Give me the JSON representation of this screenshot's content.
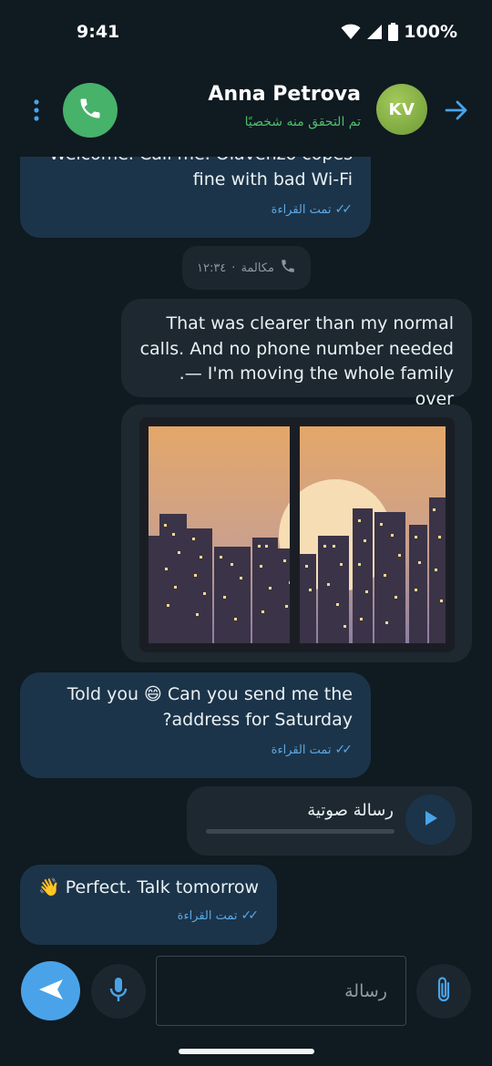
{
  "status_bar": {
    "time": "9:41",
    "battery": "100%",
    "icons": [
      "wifi-icon",
      "signal-icon",
      "battery-icon"
    ]
  },
  "header": {
    "contact_name": "Anna Petrova",
    "contact_status": "تم التحقق منه شخصيًا",
    "avatar_initials": "KV",
    "icons": [
      "more-vertical-icon",
      "phone-icon",
      "arrow-right-icon"
    ]
  },
  "messages": [
    {
      "id": "m1",
      "direction": "incoming",
      "text_clipped": "Welcome. Call me. Olavenzo copes",
      "text": "fine with bad Wi-Fi",
      "receipt": "تمت القراءة"
    },
    {
      "id": "call",
      "type": "call-event",
      "label": "مكالمة",
      "time": "١٢:٣٤"
    },
    {
      "id": "m2",
      "direction": "outgoing",
      "text": "That was clearer than my normal\ncalls. And no phone number needed\n.— I'm moving the whole family over"
    },
    {
      "id": "m3",
      "direction": "outgoing",
      "type": "image",
      "image_subject": "city skyline at sunset through a window"
    },
    {
      "id": "m4",
      "direction": "incoming",
      "text": "Told you 😄 Can you send me the\n?address for Saturday",
      "receipt": "تمت القراءة"
    },
    {
      "id": "m5",
      "direction": "outgoing",
      "type": "voice",
      "label": "رسالة صوتية",
      "progress": 0
    },
    {
      "id": "m6",
      "direction": "incoming",
      "text": "👋 Perfect. Talk tomorrow",
      "receipt": "تمت القراءة"
    }
  ],
  "composer": {
    "placeholder": "رسالة",
    "value": "",
    "icons": [
      "send-icon",
      "microphone-icon",
      "paperclip-icon"
    ]
  },
  "colors": {
    "background": "#0f1a21",
    "incoming_bubble": "#1c3449",
    "outgoing_bubble": "#1d2830",
    "accent": "#4aa3e8",
    "call_green": "#46b26a",
    "verified_green": "#4cc069"
  }
}
